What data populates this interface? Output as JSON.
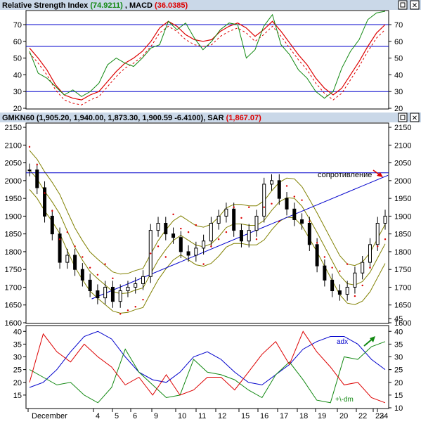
{
  "colors": {
    "titlebar": "#cad8e8",
    "panel": "#ffffff",
    "frame": "#000000",
    "blue": "#0000cc",
    "green": "#118811",
    "red": "#dd0000",
    "olive": "#808000",
    "tick": "#000000"
  },
  "rsi_panel": {
    "title_prefix": "Relative Strength Index",
    "rsi_value": "(74.9211)",
    "macd_label": ", MACD",
    "macd_value": "(36.0385)",
    "ytick_labels": [
      "70",
      "60",
      "50",
      "40",
      "30",
      "20"
    ]
  },
  "price_panel": {
    "title_prefix": "GMKN60 (1,905.20, 1,940.00, 1,873.30, 1,900.59 -6.4100), SAR",
    "sar_value": "(1,867.07)",
    "ytick_labels": [
      "2150",
      "2100",
      "2050",
      "2000",
      "1950",
      "1900",
      "1850",
      "1800",
      "1750",
      "1700",
      "1650",
      "1600"
    ],
    "annotation": "сопротивление"
  },
  "dmi_panel": {
    "adx_label": "adx",
    "dm_label": "+\\-dm",
    "ytick_labels": [
      "40",
      "35",
      "30",
      "25",
      "20",
      "15"
    ],
    "ytick_labels_right": [
      "45",
      "40",
      "35",
      "30",
      "25",
      "20",
      "15",
      "10"
    ]
  },
  "x_axis": {
    "labels": [
      "December",
      "4",
      "5",
      "6",
      "9",
      "10",
      "11",
      "12",
      "15",
      "16",
      "17",
      "18",
      "19",
      "20",
      "22",
      "23",
      "24"
    ]
  },
  "window_buttons": [
    "▢",
    "✕"
  ],
  "chart_data": [
    {
      "type": "line",
      "panel": "rsi",
      "ylim": [
        20,
        78
      ],
      "hlines": [
        70,
        57,
        30
      ],
      "series": [
        {
          "name": "Relative Strength Index",
          "values": [
            54,
            41,
            38,
            33,
            28,
            31,
            27,
            30,
            35,
            46,
            50,
            47,
            45,
            50,
            56,
            58,
            72,
            67,
            71,
            62,
            55,
            60,
            67,
            71,
            70,
            50,
            55,
            69,
            76,
            58,
            52,
            43,
            38,
            30,
            26,
            30,
            44,
            54,
            61,
            73,
            77,
            78
          ]
        },
        {
          "name": "MACD",
          "values": [
            56,
            50,
            43,
            34,
            28,
            26,
            25,
            28,
            30,
            36,
            42,
            47,
            50,
            54,
            60,
            68,
            72,
            69,
            64,
            61,
            60,
            61,
            66,
            69,
            71,
            68,
            63,
            67,
            72,
            66,
            59,
            52,
            46,
            38,
            32,
            28,
            32,
            40,
            48,
            57,
            65,
            70
          ]
        }
      ]
    },
    {
      "type": "line",
      "panel": "price",
      "ylim": [
        1600,
        2160
      ],
      "hlines": [
        2022
      ],
      "trendline": {
        "from": [
          0.18,
          1667
        ],
        "to": [
          1.0,
          2015
        ]
      },
      "series": [
        {
          "name": "GMKN60",
          "values": [
            2030,
            1980,
            1900,
            1850,
            1770,
            1790,
            1750,
            1720,
            1690,
            1670,
            1700,
            1660,
            1690,
            1700,
            1710,
            1730,
            1860,
            1880,
            1850,
            1840,
            1800,
            1790,
            1810,
            1830,
            1880,
            1900,
            1920,
            1860,
            1830,
            1860,
            1900,
            1990,
            2000,
            1950,
            1920,
            1890,
            1880,
            1820,
            1760,
            1720,
            1690,
            1680,
            1700,
            1740,
            1770,
            1820,
            1880,
            1900
          ]
        }
      ]
    },
    {
      "type": "line",
      "panel": "dmi",
      "ylim": [
        10,
        42
      ],
      "series": [
        {
          "name": "adx",
          "values": [
            18,
            20,
            25,
            32,
            38,
            40,
            37,
            30,
            24,
            21,
            20,
            24,
            30,
            32,
            29,
            24,
            20,
            19,
            23,
            27,
            33,
            36,
            38,
            38,
            35,
            29,
            25
          ]
        },
        {
          "name": "+\\-dm",
          "values": [
            25,
            22,
            19,
            20,
            15,
            12,
            18,
            33,
            24,
            19,
            14,
            15,
            29,
            24,
            23,
            21,
            17,
            14,
            23,
            28,
            21,
            13,
            12,
            30,
            29,
            34,
            36
          ]
        },
        {
          "values": [
            20,
            39,
            32,
            28,
            35,
            30,
            26,
            19,
            22,
            15,
            23,
            15,
            17,
            22,
            22,
            17,
            24,
            31,
            36,
            27,
            40,
            32,
            26,
            19,
            20,
            14,
            12
          ]
        }
      ]
    }
  ]
}
